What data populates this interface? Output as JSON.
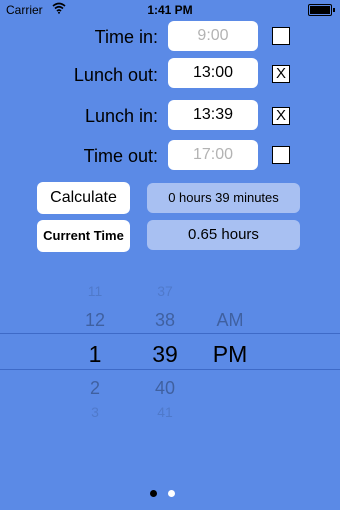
{
  "status": {
    "carrier": "Carrier",
    "time": "1:41 PM"
  },
  "rows": [
    {
      "label": "Time in:",
      "value": "9:00",
      "checked": ""
    },
    {
      "label": "Lunch out:",
      "value": "13:00",
      "checked": "X"
    },
    {
      "label": "Lunch in:",
      "value": "13:39",
      "checked": "X"
    },
    {
      "label": "Time out:",
      "value": "17:00",
      "checked": ""
    }
  ],
  "buttons": {
    "calculate": "Calculate",
    "current_time": "Current Time"
  },
  "results": {
    "duration": "0 hours 39 minutes",
    "decimal": "0.65 hours"
  },
  "picker": {
    "hours": [
      "11",
      "12",
      "1",
      "2",
      "3"
    ],
    "minutes": [
      "37",
      "38",
      "39",
      "40",
      "41"
    ],
    "ampm": [
      "AM",
      "PM"
    ]
  },
  "page_control": {
    "pages": 2,
    "current": 1
  }
}
